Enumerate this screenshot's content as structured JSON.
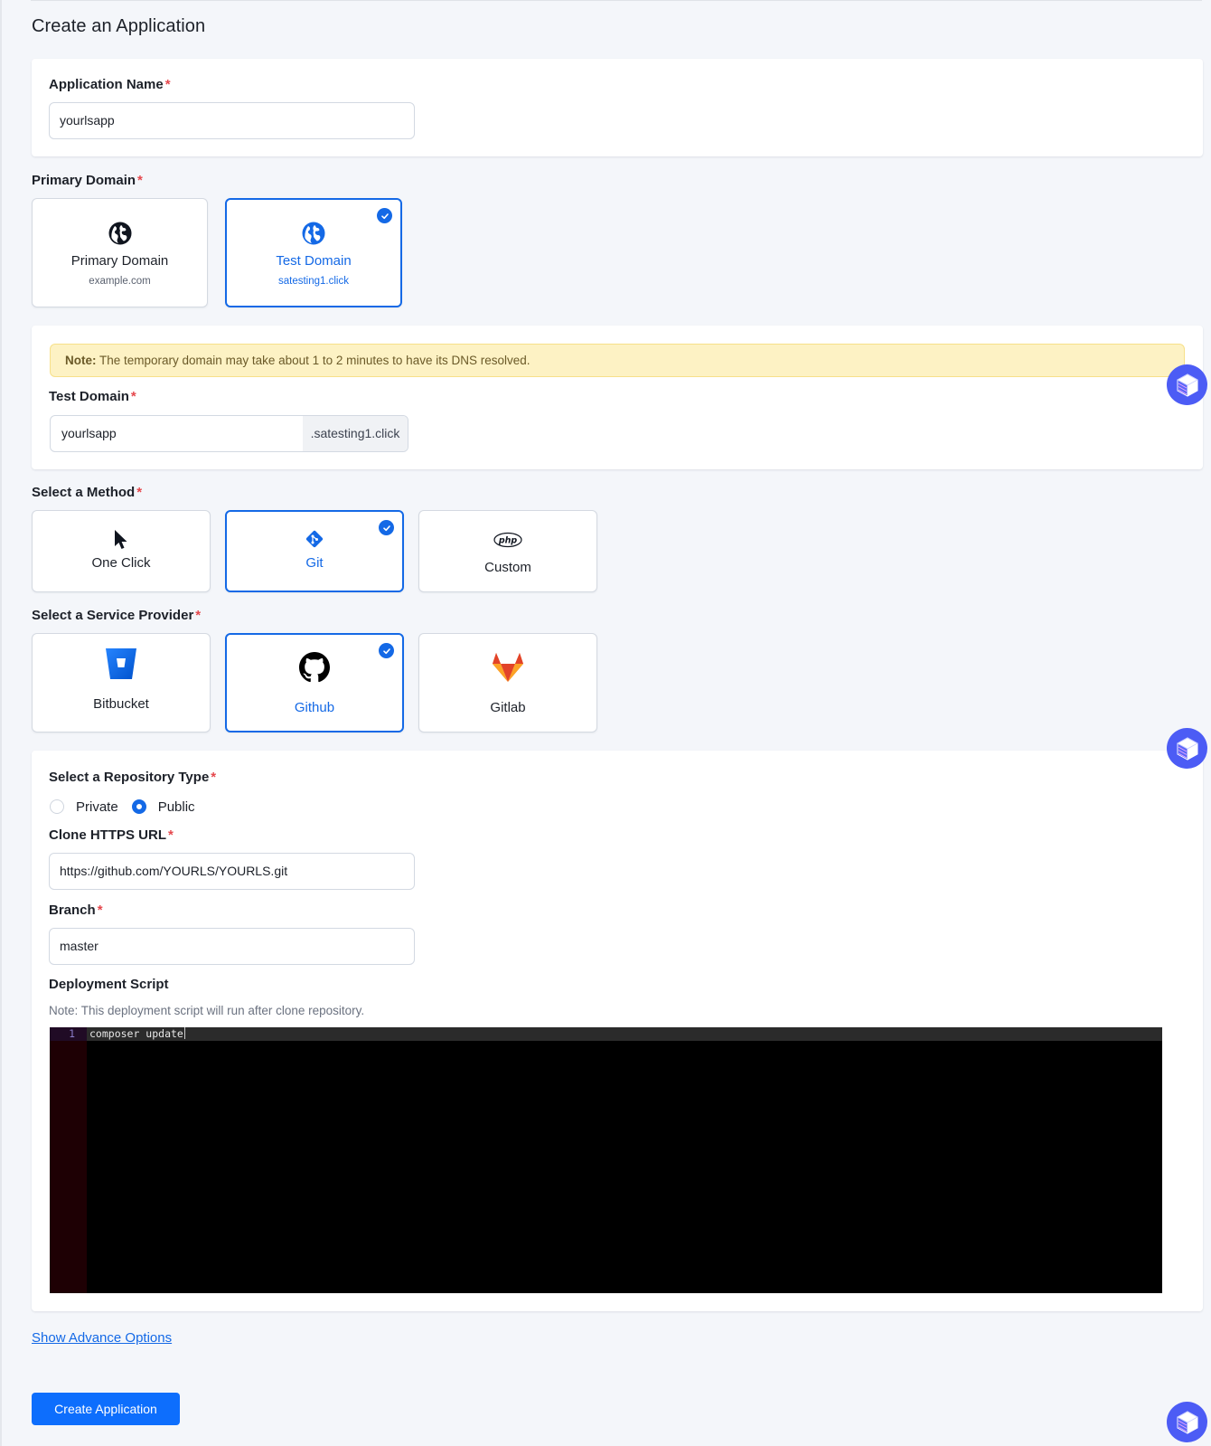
{
  "page": {
    "title": "Create an Application"
  },
  "app_name": {
    "label": "Application Name",
    "required_marker": "*",
    "value": "yourlsapp"
  },
  "primary_domain": {
    "label": "Primary Domain",
    "required_marker": "*",
    "options": [
      {
        "title": "Primary Domain",
        "subtitle": "example.com",
        "icon": "globe-icon",
        "selected": false
      },
      {
        "title": "Test Domain",
        "subtitle": "satesting1.click",
        "icon": "globe-icon",
        "selected": true
      }
    ]
  },
  "test_domain": {
    "note_prefix": "Note:",
    "note_text": " The temporary domain may take about 1 to 2 minutes to have its DNS resolved.",
    "label": "Test Domain",
    "required_marker": "*",
    "value": "yourlsapp",
    "suffix": ".satesting1.click"
  },
  "method": {
    "label": "Select a Method",
    "required_marker": "*",
    "options": [
      {
        "title": "One Click",
        "icon": "cursor-pointer-icon",
        "selected": false
      },
      {
        "title": "Git",
        "icon": "git-icon",
        "selected": true
      },
      {
        "title": "Custom",
        "icon": "php-icon",
        "selected": false
      }
    ]
  },
  "provider": {
    "label": "Select a Service Provider",
    "required_marker": "*",
    "options": [
      {
        "title": "Bitbucket",
        "icon": "bitbucket-icon",
        "selected": false
      },
      {
        "title": "Github",
        "icon": "github-icon",
        "selected": true
      },
      {
        "title": "Gitlab",
        "icon": "gitlab-icon",
        "selected": false
      }
    ]
  },
  "repository": {
    "type_label": "Select a Repository Type",
    "required_marker": "*",
    "types": [
      {
        "label": "Private",
        "selected": false
      },
      {
        "label": "Public",
        "selected": true
      }
    ],
    "clone_label": "Clone HTTPS URL",
    "clone_value": "https://github.com/YOURLS/YOURLS.git",
    "branch_label": "Branch",
    "branch_value": "master",
    "script_label": "Deployment Script",
    "script_note": "Note: This deployment script will run after clone repository.",
    "script_lines": [
      {
        "number": "1",
        "code": "composer update"
      }
    ]
  },
  "actions": {
    "advanced_link": "Show Advance Options",
    "submit": "Create Application"
  },
  "colors": {
    "accent": "#1469e6",
    "button": "#0d6efd",
    "required": "#e5484d",
    "note_bg": "#fdf2c4",
    "float_button": "#4c5cf5"
  }
}
